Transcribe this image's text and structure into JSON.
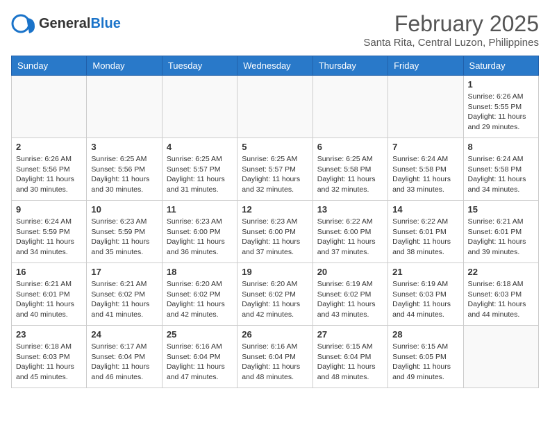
{
  "header": {
    "logo_general": "General",
    "logo_blue": "Blue",
    "month_year": "February 2025",
    "location": "Santa Rita, Central Luzon, Philippines"
  },
  "weekdays": [
    "Sunday",
    "Monday",
    "Tuesday",
    "Wednesday",
    "Thursday",
    "Friday",
    "Saturday"
  ],
  "weeks": [
    [
      {
        "day": "",
        "info": ""
      },
      {
        "day": "",
        "info": ""
      },
      {
        "day": "",
        "info": ""
      },
      {
        "day": "",
        "info": ""
      },
      {
        "day": "",
        "info": ""
      },
      {
        "day": "",
        "info": ""
      },
      {
        "day": "1",
        "info": "Sunrise: 6:26 AM\nSunset: 5:55 PM\nDaylight: 11 hours and 29 minutes."
      }
    ],
    [
      {
        "day": "2",
        "info": "Sunrise: 6:26 AM\nSunset: 5:56 PM\nDaylight: 11 hours and 30 minutes."
      },
      {
        "day": "3",
        "info": "Sunrise: 6:25 AM\nSunset: 5:56 PM\nDaylight: 11 hours and 30 minutes."
      },
      {
        "day": "4",
        "info": "Sunrise: 6:25 AM\nSunset: 5:57 PM\nDaylight: 11 hours and 31 minutes."
      },
      {
        "day": "5",
        "info": "Sunrise: 6:25 AM\nSunset: 5:57 PM\nDaylight: 11 hours and 32 minutes."
      },
      {
        "day": "6",
        "info": "Sunrise: 6:25 AM\nSunset: 5:58 PM\nDaylight: 11 hours and 32 minutes."
      },
      {
        "day": "7",
        "info": "Sunrise: 6:24 AM\nSunset: 5:58 PM\nDaylight: 11 hours and 33 minutes."
      },
      {
        "day": "8",
        "info": "Sunrise: 6:24 AM\nSunset: 5:58 PM\nDaylight: 11 hours and 34 minutes."
      }
    ],
    [
      {
        "day": "9",
        "info": "Sunrise: 6:24 AM\nSunset: 5:59 PM\nDaylight: 11 hours and 34 minutes."
      },
      {
        "day": "10",
        "info": "Sunrise: 6:23 AM\nSunset: 5:59 PM\nDaylight: 11 hours and 35 minutes."
      },
      {
        "day": "11",
        "info": "Sunrise: 6:23 AM\nSunset: 6:00 PM\nDaylight: 11 hours and 36 minutes."
      },
      {
        "day": "12",
        "info": "Sunrise: 6:23 AM\nSunset: 6:00 PM\nDaylight: 11 hours and 37 minutes."
      },
      {
        "day": "13",
        "info": "Sunrise: 6:22 AM\nSunset: 6:00 PM\nDaylight: 11 hours and 37 minutes."
      },
      {
        "day": "14",
        "info": "Sunrise: 6:22 AM\nSunset: 6:01 PM\nDaylight: 11 hours and 38 minutes."
      },
      {
        "day": "15",
        "info": "Sunrise: 6:21 AM\nSunset: 6:01 PM\nDaylight: 11 hours and 39 minutes."
      }
    ],
    [
      {
        "day": "16",
        "info": "Sunrise: 6:21 AM\nSunset: 6:01 PM\nDaylight: 11 hours and 40 minutes."
      },
      {
        "day": "17",
        "info": "Sunrise: 6:21 AM\nSunset: 6:02 PM\nDaylight: 11 hours and 41 minutes."
      },
      {
        "day": "18",
        "info": "Sunrise: 6:20 AM\nSunset: 6:02 PM\nDaylight: 11 hours and 42 minutes."
      },
      {
        "day": "19",
        "info": "Sunrise: 6:20 AM\nSunset: 6:02 PM\nDaylight: 11 hours and 42 minutes."
      },
      {
        "day": "20",
        "info": "Sunrise: 6:19 AM\nSunset: 6:02 PM\nDaylight: 11 hours and 43 minutes."
      },
      {
        "day": "21",
        "info": "Sunrise: 6:19 AM\nSunset: 6:03 PM\nDaylight: 11 hours and 44 minutes."
      },
      {
        "day": "22",
        "info": "Sunrise: 6:18 AM\nSunset: 6:03 PM\nDaylight: 11 hours and 44 minutes."
      }
    ],
    [
      {
        "day": "23",
        "info": "Sunrise: 6:18 AM\nSunset: 6:03 PM\nDaylight: 11 hours and 45 minutes."
      },
      {
        "day": "24",
        "info": "Sunrise: 6:17 AM\nSunset: 6:04 PM\nDaylight: 11 hours and 46 minutes."
      },
      {
        "day": "25",
        "info": "Sunrise: 6:16 AM\nSunset: 6:04 PM\nDaylight: 11 hours and 47 minutes."
      },
      {
        "day": "26",
        "info": "Sunrise: 6:16 AM\nSunset: 6:04 PM\nDaylight: 11 hours and 48 minutes."
      },
      {
        "day": "27",
        "info": "Sunrise: 6:15 AM\nSunset: 6:04 PM\nDaylight: 11 hours and 48 minutes."
      },
      {
        "day": "28",
        "info": "Sunrise: 6:15 AM\nSunset: 6:05 PM\nDaylight: 11 hours and 49 minutes."
      },
      {
        "day": "",
        "info": ""
      }
    ]
  ]
}
